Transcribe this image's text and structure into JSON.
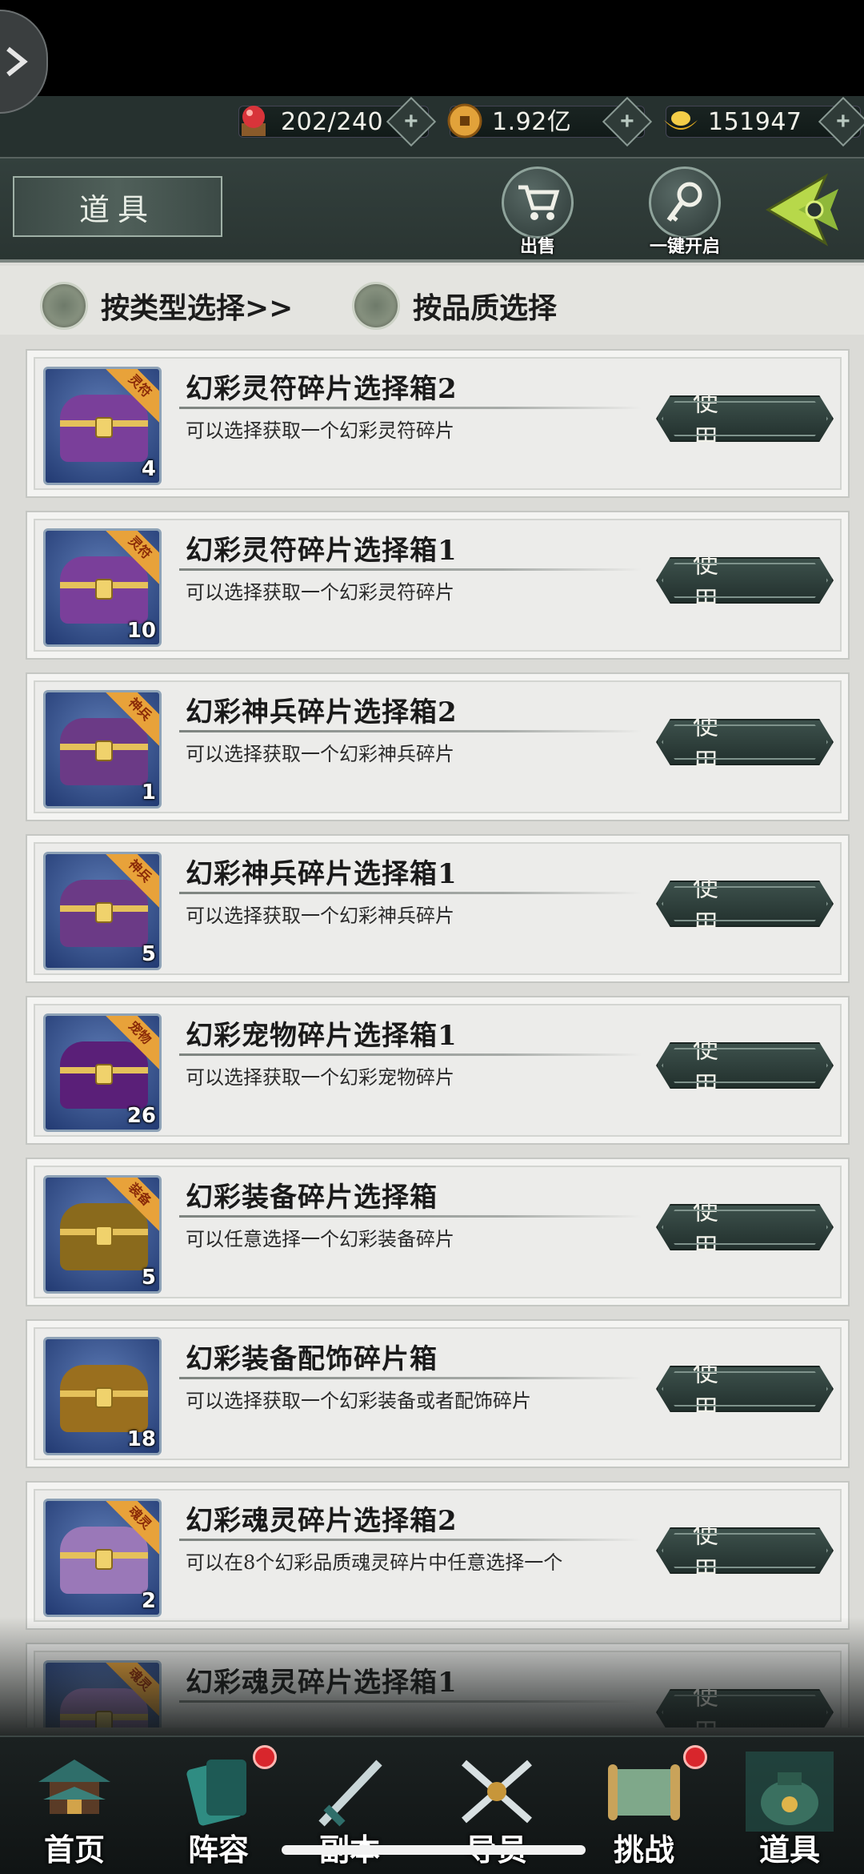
{
  "currency": {
    "stamina": "202/240",
    "coins": "1.92亿",
    "ingots": "151947"
  },
  "header": {
    "title": "道具",
    "sell_label": "出售",
    "open_all_label": "一键开启"
  },
  "filters": {
    "by_type": "按类型选择>>",
    "by_quality": "按品质选择"
  },
  "use_label": "使 用",
  "items": [
    {
      "name": "幻彩灵符碎片选择箱2",
      "desc": "可以选择获取一个幻彩灵符碎片",
      "count": "4",
      "tag": "灵符",
      "color": "#7a3f9a"
    },
    {
      "name": "幻彩灵符碎片选择箱1",
      "desc": "可以选择获取一个幻彩灵符碎片",
      "count": "10",
      "tag": "灵符",
      "color": "#7a3f9a"
    },
    {
      "name": "幻彩神兵碎片选择箱2",
      "desc": "可以选择获取一个幻彩神兵碎片",
      "count": "1",
      "tag": "神兵",
      "color": "#6b3a86"
    },
    {
      "name": "幻彩神兵碎片选择箱1",
      "desc": "可以选择获取一个幻彩神兵碎片",
      "count": "5",
      "tag": "神兵",
      "color": "#6b3a86"
    },
    {
      "name": "幻彩宠物碎片选择箱1",
      "desc": "可以选择获取一个幻彩宠物碎片",
      "count": "26",
      "tag": "宠物",
      "color": "#5a1f78"
    },
    {
      "name": "幻彩装备碎片选择箱",
      "desc": "可以任意选择一个幻彩装备碎片",
      "count": "5",
      "tag": "装备",
      "color": "#8a6a1c"
    },
    {
      "name": "幻彩装备配饰碎片箱",
      "desc": "可以选择获取一个幻彩装备或者配饰碎片",
      "count": "18",
      "tag": "",
      "color": "#9a6f1e"
    },
    {
      "name": "幻彩魂灵碎片选择箱2",
      "desc": "可以在8个幻彩品质魂灵碎片中任意选择一个",
      "count": "2",
      "tag": "魂灵",
      "color": "#9a78b8"
    },
    {
      "name": "幻彩魂灵碎片选择箱1",
      "desc": "",
      "count": "",
      "tag": "魂灵",
      "color": "#9a78b8"
    }
  ],
  "nav": {
    "home": "首页",
    "lineup": "阵容",
    "dungeon": "副本",
    "hero": "导员",
    "challenge": "挑战",
    "items": "道具"
  }
}
